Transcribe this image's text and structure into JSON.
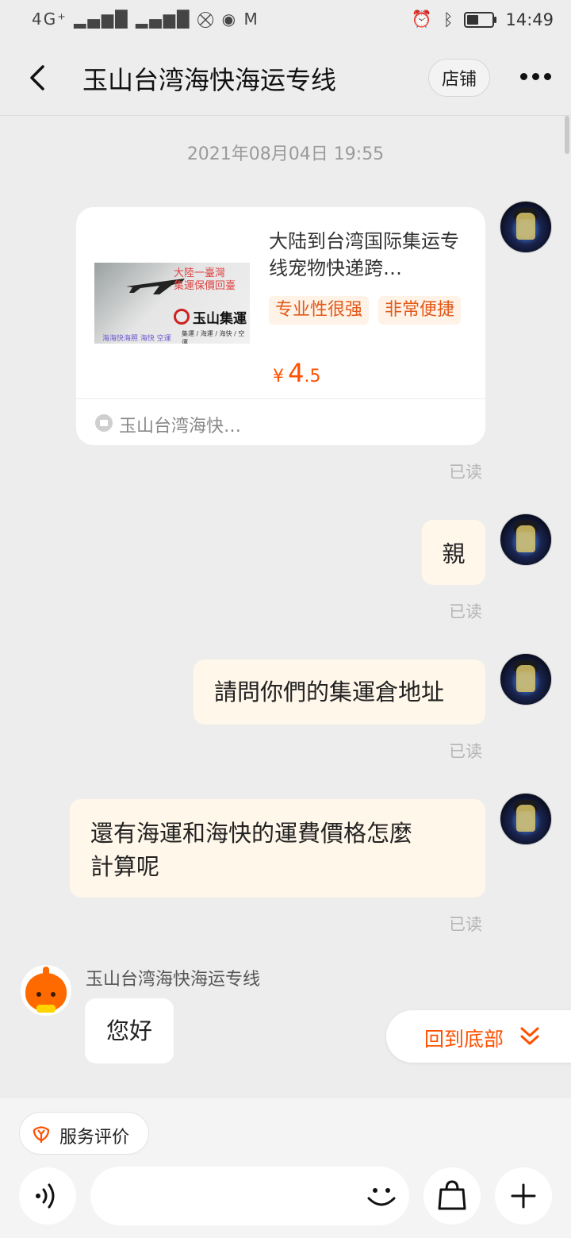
{
  "status_bar": {
    "left_icons": "4G⁺ ▂▄▆█ ▂▄▆█ ⛒ ◉ M",
    "time": "14:49",
    "battery_level": 0.55
  },
  "header": {
    "title": "玉山台湾海快海运专线",
    "shop_button": "店铺",
    "back_icon": "chevron-left-icon",
    "more_icon": "more-dots-icon"
  },
  "chat": {
    "timestamp": "2021年08月04日 19:55",
    "product_card": {
      "image_text": {
        "line1": "大陸一臺灣",
        "line2": "集運保價回臺",
        "brand": "玉山集運",
        "services": "集運 / 海運 / 海快 / 空運",
        "bottom": "海海快海照 海快 空運"
      },
      "title": "大陆到台湾国际集运专线宠物快递跨…",
      "tags": [
        "专业性很强",
        "非常便捷"
      ],
      "price_symbol": "¥",
      "price_int": "4",
      "price_dec": ".5",
      "shop_name": "玉山台湾海快…",
      "read_status": "已读"
    },
    "messages": [
      {
        "text": "親",
        "read_status": "已读"
      },
      {
        "text": "請問你們的集運倉地址",
        "read_status": "已读"
      },
      {
        "text_line1": "還有海運和海快的運費價格怎麼",
        "text_line2": "計算呢",
        "read_status": "已读"
      }
    ],
    "shop_reply": {
      "sender": "玉山台湾海快海运专线",
      "text": "您好"
    },
    "back_to_bottom": "回到底部"
  },
  "bottom_bar": {
    "rating_label": "服务评价",
    "input_placeholder": "",
    "voice_icon": "voice-icon",
    "emoji_icon": "emoji-icon",
    "product_icon": "shopping-bag-icon",
    "add_icon": "plus-icon"
  },
  "colors": {
    "accent": "#ff5000",
    "bubble_me": "#fff7ea",
    "background": "#ededed"
  }
}
